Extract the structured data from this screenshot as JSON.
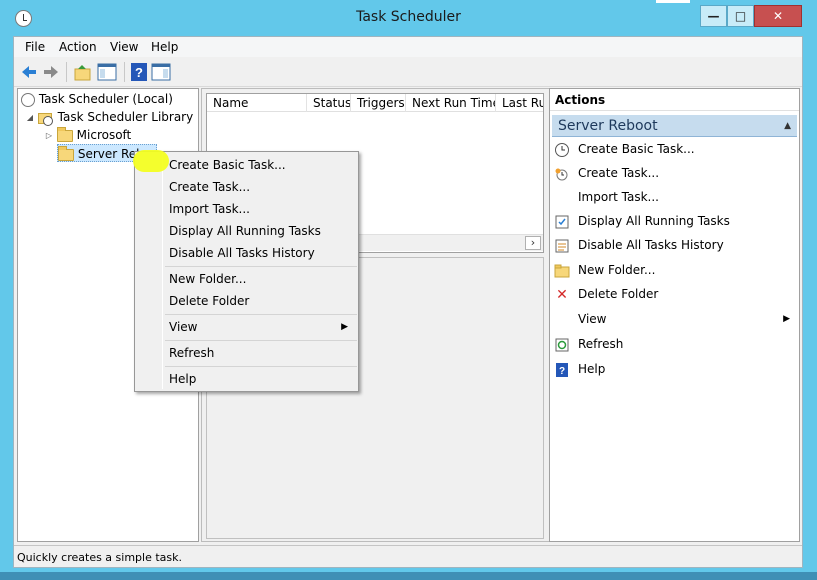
{
  "window": {
    "title": "Task Scheduler"
  },
  "menubar": {
    "items": [
      "File",
      "Action",
      "View",
      "Help"
    ]
  },
  "tree": {
    "root": "Task Scheduler (Local)",
    "library": "Task Scheduler Library",
    "children": [
      "Microsoft",
      "Server Reboot"
    ]
  },
  "list": {
    "columns": [
      "Name",
      "Status",
      "Triggers",
      "Next Run Time",
      "Last Ru"
    ]
  },
  "actions": {
    "header": "Actions",
    "section": "Server Reboot",
    "items": [
      {
        "label": "Create Basic Task...",
        "icon": "create-basic-task-icon"
      },
      {
        "label": "Create Task...",
        "icon": "create-task-icon"
      },
      {
        "label": "Import Task...",
        "icon": ""
      },
      {
        "label": "Display All Running Tasks",
        "icon": "running-tasks-icon"
      },
      {
        "label": "Disable All Tasks History",
        "icon": "history-icon"
      },
      {
        "label": "New Folder...",
        "icon": "folder-icon"
      },
      {
        "label": "Delete Folder",
        "icon": "delete-icon"
      },
      {
        "label": "View",
        "icon": ""
      },
      {
        "label": "Refresh",
        "icon": "refresh-icon"
      },
      {
        "label": "Help",
        "icon": "help-icon"
      }
    ]
  },
  "context_menu": {
    "items": [
      "Create Basic Task...",
      "Create Task...",
      "Import Task...",
      "Display All Running Tasks",
      "Disable All Tasks History",
      "New Folder...",
      "Delete Folder",
      "View",
      "Refresh",
      "Help"
    ]
  },
  "status": {
    "text": "Quickly creates a simple task."
  },
  "colors": {
    "titlebar": "#62c8ea",
    "highlight": "#f4ff1c",
    "close": "#c75050",
    "section": "#c6dcee"
  }
}
